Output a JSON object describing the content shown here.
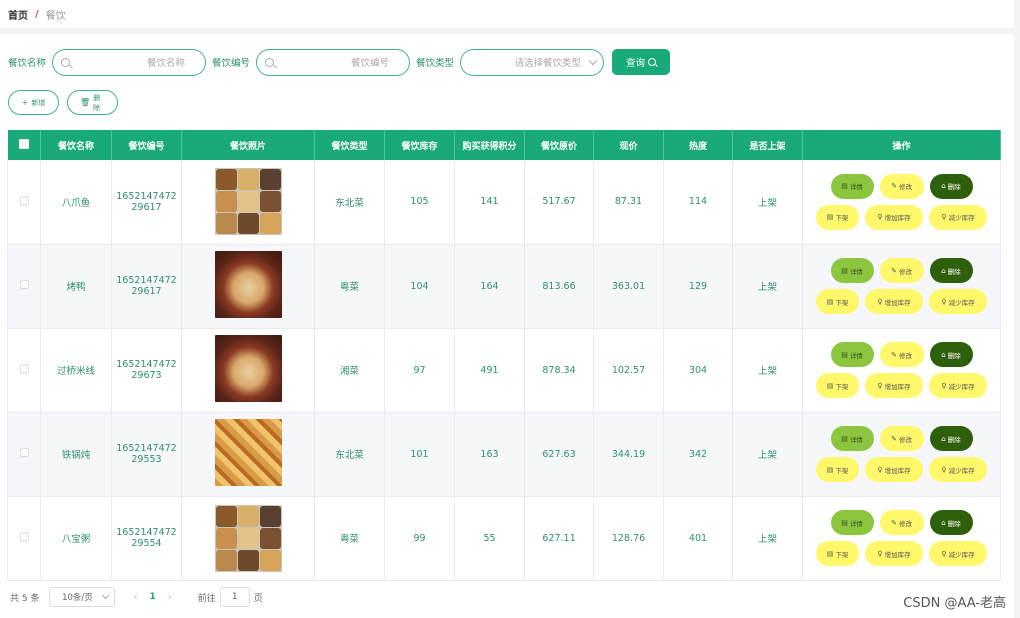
{
  "breadcrumb": {
    "home": "首页",
    "sep": "/",
    "current": "餐饮"
  },
  "search": {
    "name_label": "餐饮名称",
    "name_placeholder": "餐饮名称",
    "code_label": "餐饮编号",
    "code_placeholder": "餐饮编号",
    "type_label": "餐饮类型",
    "type_placeholder": "请选择餐饮类型",
    "query_label": "查询"
  },
  "actions": {
    "add_icon": "+",
    "add_label": "新增",
    "delete_icon": "🗑",
    "delete_label": "删除"
  },
  "columns": [
    "餐饮名称",
    "餐饮编号",
    "餐饮照片",
    "餐饮类型",
    "餐饮库存",
    "购买获得积分",
    "餐饮原价",
    "现价",
    "热度",
    "是否上架",
    "操作"
  ],
  "rows": [
    {
      "name": "八爪鱼",
      "code1": "1652147472",
      "code2": "29617",
      "photo": "dish-collage",
      "type": "东北菜",
      "stock": "105",
      "points": "141",
      "orig": "517.67",
      "price": "87.31",
      "heat": "114",
      "status": "上架"
    },
    {
      "name": "烤鸭",
      "code1": "1652147472",
      "code2": "29617",
      "photo": "pizza",
      "type": "粤菜",
      "stock": "104",
      "points": "164",
      "orig": "813.66",
      "price": "363.01",
      "heat": "129",
      "status": "上架"
    },
    {
      "name": "过桥米线",
      "code1": "1652147472",
      "code2": "29673",
      "photo": "pizza",
      "type": "湘菜",
      "stock": "97",
      "points": "491",
      "orig": "878.34",
      "price": "102.57",
      "heat": "304",
      "status": "上架"
    },
    {
      "name": "铁锅炖",
      "code1": "1652147472",
      "code2": "29553",
      "photo": "fried-bread",
      "type": "东北菜",
      "stock": "101",
      "points": "163",
      "orig": "627.63",
      "price": "344.19",
      "heat": "342",
      "status": "上架"
    },
    {
      "name": "八宝粥",
      "code1": "1652147472",
      "code2": "29554",
      "photo": "dish-collage",
      "type": "粤菜",
      "stock": "99",
      "points": "55",
      "orig": "627.11",
      "price": "128.76",
      "heat": "401",
      "status": "上架"
    }
  ],
  "ops": {
    "detail": "详情",
    "edit": "修改",
    "delete": "删除",
    "down": "下架",
    "add_stock": "增加库存",
    "sub_stock": "减少库存"
  },
  "pager": {
    "total": "共 5 条",
    "size": "10条/页",
    "prev": "‹",
    "current": "1",
    "next": "›",
    "goto": "前往",
    "goto_value": "1",
    "page_unit": "页"
  },
  "watermark": "CSDN @AA-老高",
  "colors": {
    "accent": "#1aaa7a",
    "detail_btn": "#8cc63f",
    "yellow_btn": "#fff86b",
    "dark_btn": "#2e5f0b"
  }
}
